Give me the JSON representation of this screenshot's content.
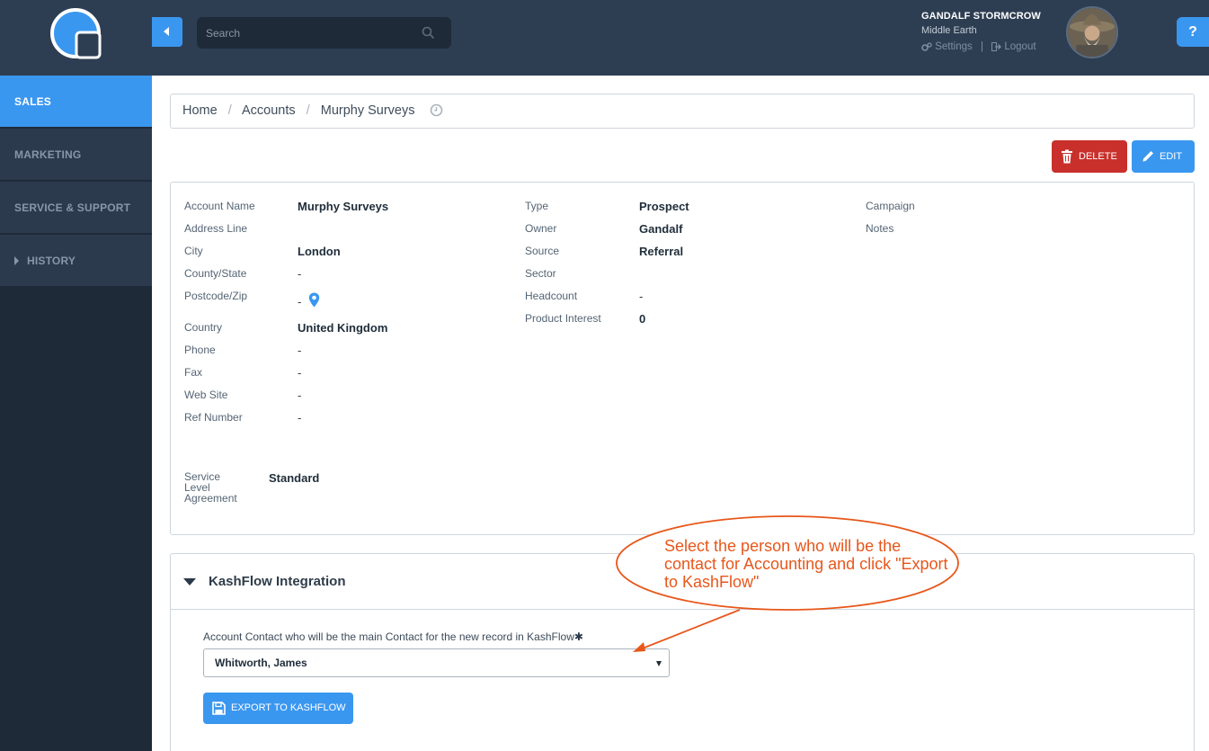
{
  "sidebar": {
    "logo_icon": "app-logo-icon",
    "items": [
      {
        "label": "SALES",
        "active": true
      },
      {
        "label": "MARKETING",
        "active": false
      },
      {
        "label": "SERVICE & SUPPORT",
        "active": false
      },
      {
        "label": "HISTORY",
        "active": false
      }
    ]
  },
  "topbar": {
    "search_placeholder": "Search",
    "user_name": "GANDALF STORMCROW",
    "user_location": "Middle Earth",
    "settings_label": "Settings",
    "separator": "|",
    "logout_label": "Logout",
    "help_label": "?"
  },
  "breadcrumb": {
    "items": [
      "Home",
      "Accounts",
      "Murphy Surveys"
    ],
    "separator": "/"
  },
  "actions": {
    "delete_label": "DELETE",
    "edit_label": "EDIT"
  },
  "account": {
    "col1": [
      {
        "label": "Account Name",
        "value": "Murphy Surveys"
      },
      {
        "label": "Address Line",
        "value": ""
      },
      {
        "label": "City",
        "value": "London"
      },
      {
        "label": "County/State",
        "value": "-"
      },
      {
        "label": "Postcode/Zip",
        "value": "-"
      },
      {
        "label": "Country",
        "value": "United Kingdom"
      },
      {
        "label": "Phone",
        "value": "-"
      },
      {
        "label": "Fax",
        "value": "-"
      },
      {
        "label": "Web Site",
        "value": "-"
      },
      {
        "label": "Ref Number",
        "value": "-"
      }
    ],
    "col2": [
      {
        "label": "Type",
        "value": "Prospect"
      },
      {
        "label": "Owner",
        "value": "Gandalf"
      },
      {
        "label": "Source",
        "value": "Referral"
      },
      {
        "label": "Sector",
        "value": ""
      },
      {
        "label": "Headcount",
        "value": "-"
      },
      {
        "label": "Product Interest",
        "value": "0"
      }
    ],
    "col3": [
      {
        "label": "Campaign",
        "value": ""
      },
      {
        "label": "Notes",
        "value": ""
      }
    ],
    "sla_label": "Service Level Agreement",
    "sla_value": "Standard"
  },
  "kashflow": {
    "title": "KashFlow Integration",
    "contact_label": "Account Contact who will be the main Contact for the new record in KashFlow",
    "required_mark": "✱",
    "selected_contact": "Whitworth, James",
    "export_label": "EXPORT TO KASHFLOW"
  },
  "annotation": {
    "text": "Select the person who will be the contact for Accounting and click \"Export to KashFlow\"",
    "color": "#e8561a"
  },
  "colors": {
    "accent": "#3a97f0",
    "danger": "#c9302c",
    "sidebar_bg": "#1f2a38",
    "topbar_bg": "#2e3e52"
  }
}
